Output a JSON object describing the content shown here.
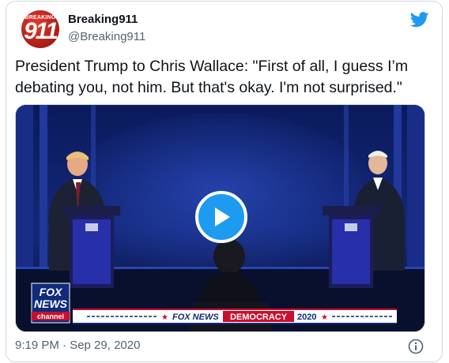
{
  "tweet": {
    "author_name": "Breaking911",
    "author_handle": "@Breaking911",
    "avatar_text_top": "BREAKING",
    "avatar_text_main": "911",
    "text": "President Trump to Chris Wallace: \"First of all, I guess I’m debating you, not him. But that's okay. I'm not surprised.\"",
    "timestamp": "9:19 PM · Sep 29, 2020"
  },
  "video": {
    "network_logo_line1": "FOX",
    "network_logo_line2": "NEWS",
    "network_logo_line3": "channel",
    "ticker_network": "FOX NEWS",
    "ticker_event": "DEMOCRACY",
    "ticker_year": "2020"
  },
  "icons": {
    "brand": "twitter-bird-icon",
    "play": "play-icon",
    "info": "info-icon"
  },
  "colors": {
    "twitter_blue": "#1d9bf0",
    "text_primary": "#0f1419",
    "text_secondary": "#536471",
    "border": "#cfd9de",
    "fox_red": "#c8102e"
  }
}
